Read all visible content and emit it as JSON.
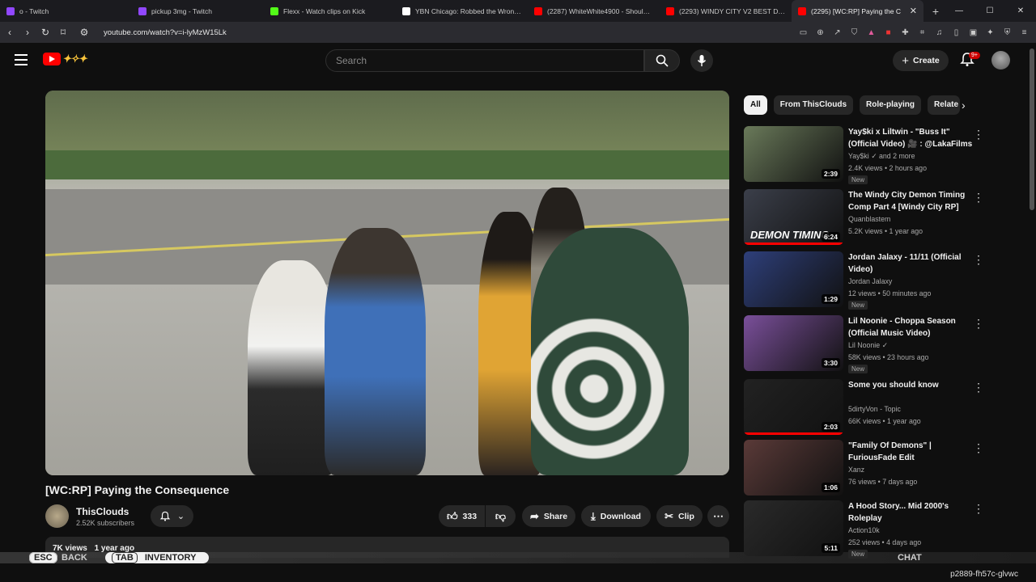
{
  "browser": {
    "tabs": [
      {
        "title": "o - Twitch",
        "favicon_color": "#9147ff"
      },
      {
        "title": "pickup 3mg - Twitch",
        "favicon_color": "#9147ff"
      },
      {
        "title": "Flexx - Watch clips on Kick",
        "favicon_color": "#53fc18"
      },
      {
        "title": "YBN Chicago: Robbed the Wrong Ta",
        "favicon_color": "#ffffff"
      },
      {
        "title": "(2287) WhiteWhite4900 - Shoulda Sc",
        "favicon_color": "#ff0000"
      },
      {
        "title": "(2293) WINDY CITY V2 BEST DEM",
        "favicon_color": "#ff0000"
      },
      {
        "title": "(2295) [WC:RP] Paying the C",
        "favicon_color": "#ff0000"
      }
    ],
    "new_tab": "+",
    "url": "youtube.com/watch?v=i-lyMzW15Lk"
  },
  "header": {
    "search_placeholder": "Search",
    "create_label": "Create",
    "notifications_badge": "9+"
  },
  "video": {
    "title": "[WC:RP] Paying the Consequence",
    "channel": "ThisClouds",
    "subscribers": "2.52K subscribers",
    "likes": "333",
    "share_label": "Share",
    "download_label": "Download",
    "clip_label": "Clip",
    "views": "7K views",
    "age": "1 year ago"
  },
  "overlay": {
    "esc": "ESC",
    "back": "BACK",
    "tab": "TAB",
    "inventory": "INVENTORY",
    "chat": "CHAT",
    "status": "p2889-fh57c-glvwc"
  },
  "chips": [
    "All",
    "From ThisClouds",
    "Role-playing",
    "Relate"
  ],
  "recommendations": [
    {
      "title": "Yay$ki x Liltwin - \"Buss It\" (Official Video) 🎥 : @LakaFilms",
      "channel": "Yay$ki ✓ and 2 more",
      "meta": "2.4K views • 2 hours ago",
      "new": "New",
      "duration": "2:39",
      "progress": 0.0,
      "thumb_color": "#6a7a5a"
    },
    {
      "title": "The Windy City Demon Timing Comp Part 4 [Windy City RP]",
      "channel": "Quanblastem",
      "meta": "5.2K views • 1 year ago",
      "new": "",
      "duration": "6:24",
      "progress": 1.0,
      "thumb_color": "#3b3f4a",
      "overlay_text": "DEMON TIMING"
    },
    {
      "title": "Jordan Jalaxy - 11/11 (Official Video)",
      "channel": "Jordan Jalaxy",
      "meta": "12 views • 50 minutes ago",
      "new": "New",
      "duration": "1:29",
      "progress": 0.0,
      "thumb_color": "#2e3f7a"
    },
    {
      "title": "Lil Noonie - Choppa Season (Official Music Video)",
      "channel": "Lil Noonie ✓",
      "meta": "58K views • 23 hours ago",
      "new": "New",
      "duration": "3:30",
      "progress": 0.0,
      "thumb_color": "#7a4f9a"
    },
    {
      "title": "Some you should know",
      "channel": "5dirtyVon - Topic",
      "meta": "66K views • 1 year ago",
      "new": "",
      "duration": "2:03",
      "progress": 1.0,
      "thumb_color": "#222222"
    },
    {
      "title": "\"Family Of Demons\" | FuriousFade Edit",
      "channel": "Xanz",
      "meta": "76 views • 7 days ago",
      "new": "",
      "duration": "1:06",
      "progress": 0.0,
      "thumb_color": "#5a3a38"
    },
    {
      "title": "A Hood Story... Mid 2000's Roleplay",
      "channel": "Action10k",
      "meta": "252 views • 4 days ago",
      "new": "New",
      "duration": "5:11",
      "progress": 0.0,
      "thumb_color": "#2a2a2a"
    }
  ]
}
